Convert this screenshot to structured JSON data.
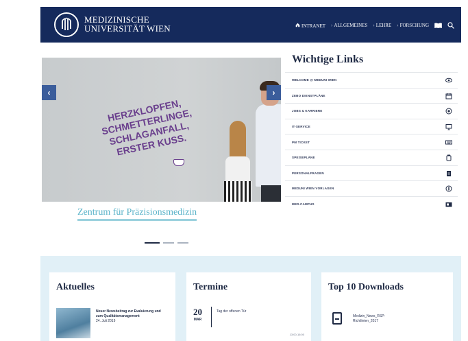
{
  "header": {
    "brand_line1": "MEDIZINISCHE",
    "brand_line2": "UNIVERSITÄT WIEN",
    "nav": [
      {
        "label": "INTRANET",
        "icon": "home-icon"
      },
      {
        "label": "ALLGEMEINES"
      },
      {
        "label": "LEHRE"
      },
      {
        "label": "FORSCHUNG"
      }
    ],
    "icons": [
      "book-icon",
      "search-icon"
    ],
    "colors": {
      "bar": "#152a5c"
    }
  },
  "slider": {
    "slide_text": [
      "HERZKLOPFEN,",
      "SCHMETTERLINGE,",
      "SCHLAGANFALL,",
      "ERSTER KUSS."
    ],
    "caption": "Zentrum für Präzisionsmedizin",
    "prev_icon": "‹",
    "next_icon": "›",
    "slides_total": 3,
    "active_slide": 1
  },
  "links": {
    "title": "Wichtige Links",
    "items": [
      {
        "label": "WELCOME @ MEDUNI WIEN",
        "icon": "eye-icon"
      },
      {
        "label": "ZEBO DIENSTPLÄNE",
        "icon": "calendar-icon"
      },
      {
        "label": "JOBS & KARRIERE",
        "icon": "target-icon"
      },
      {
        "label": "IT-SERVICE",
        "icon": "monitor-icon"
      },
      {
        "label": "PM TICKET",
        "icon": "keyboard-icon"
      },
      {
        "label": "SPEISEPLÄNE",
        "icon": "cup-icon"
      },
      {
        "label": "PERSONALFRAGEN",
        "icon": "document-icon"
      },
      {
        "label": "MEDUNI WIEN VORLAGEN",
        "icon": "circle-icon"
      },
      {
        "label": "MED.CAMPUS",
        "icon": "card-icon"
      }
    ]
  },
  "aktuelles": {
    "title": "Aktuelles",
    "item_title": "Neuer Newsbeitrag zur Evaluierung und zum Qualitätsmanagement",
    "item_date": "24. Juli 2019"
  },
  "termine": {
    "title": "Termine",
    "day": "20",
    "month": "MAR",
    "event": "Tag der offenen Tür",
    "time": "13:00-16:00"
  },
  "downloads": {
    "title": "Top 10 Downloads",
    "file_name": "Medizin_News_RSP-Richtlinien_2017"
  }
}
